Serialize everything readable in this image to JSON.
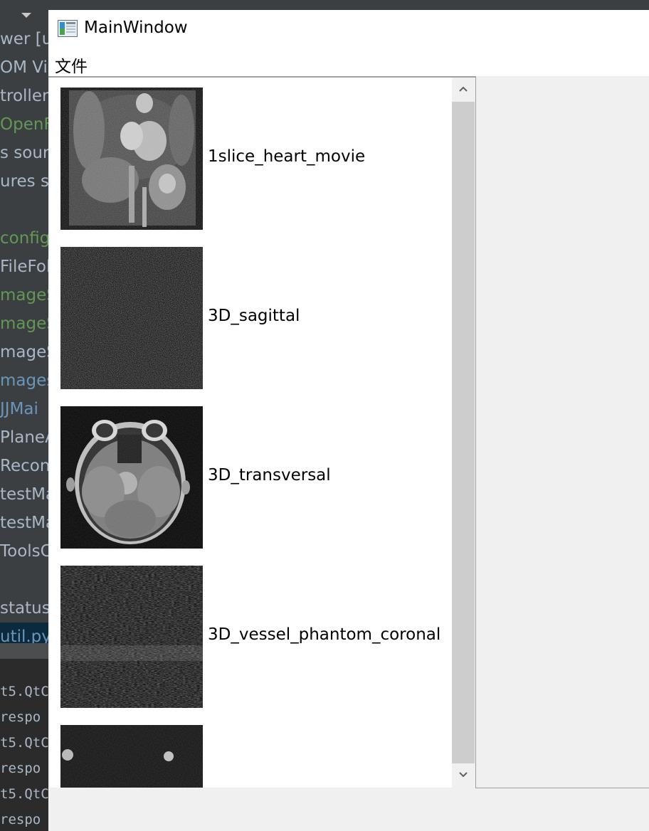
{
  "ide": {
    "tree_lines": [
      {
        "text": "wer [ur",
        "color": "#a9b7c6"
      },
      {
        "text": "OM Vi",
        "color": "#a9b7c6"
      },
      {
        "text": "troller",
        "color": "#a9b7c6"
      },
      {
        "text": "OpenF",
        "color": "#629755"
      },
      {
        "text": "s sourc",
        "color": "#a9b7c6"
      },
      {
        "text": "ures sc",
        "color": "#a9b7c6"
      },
      {
        "text": "",
        "color": "#a9b7c6"
      },
      {
        "text": "config.",
        "color": "#629755"
      },
      {
        "text": "FileFol",
        "color": "#a9b7c6"
      },
      {
        "text": "mageS",
        "color": "#629755"
      },
      {
        "text": "mageS",
        "color": "#629755"
      },
      {
        "text": "mageS",
        "color": "#a9b7c6"
      },
      {
        "text": "mages",
        "color": "#6897bb"
      },
      {
        "text": "JJMai",
        "color": "#6897bb"
      },
      {
        "text": "PlaneA",
        "color": "#a9b7c6"
      },
      {
        "text": "Recons",
        "color": "#a9b7c6"
      },
      {
        "text": "testMa",
        "color": "#a9b7c6"
      },
      {
        "text": "testMa",
        "color": "#a9b7c6"
      },
      {
        "text": "ToolsC",
        "color": "#a9b7c6"
      },
      {
        "text": "",
        "color": "#a9b7c6"
      },
      {
        "text": "status.",
        "color": "#a9b7c6"
      },
      {
        "text": "util.py",
        "color": "#6897bb"
      }
    ],
    "console_lines": [
      "t5.QtC",
      "respo",
      "t5.QtC",
      "respo",
      "t5.QtC",
      "respo"
    ]
  },
  "window": {
    "title": "MainWindow",
    "menu": {
      "file": "文件"
    }
  },
  "image_list": {
    "items": [
      {
        "label": "1slice_heart_movie",
        "thumb": "heart-mri"
      },
      {
        "label": "3D_sagittal",
        "thumb": "noise-mri"
      },
      {
        "label": "3D_transversal",
        "thumb": "brain-mri"
      },
      {
        "label": "3D_vessel_phantom_coronal",
        "thumb": "vessel-phantom"
      },
      {
        "label": "",
        "thumb": "phantom-dots"
      }
    ]
  }
}
